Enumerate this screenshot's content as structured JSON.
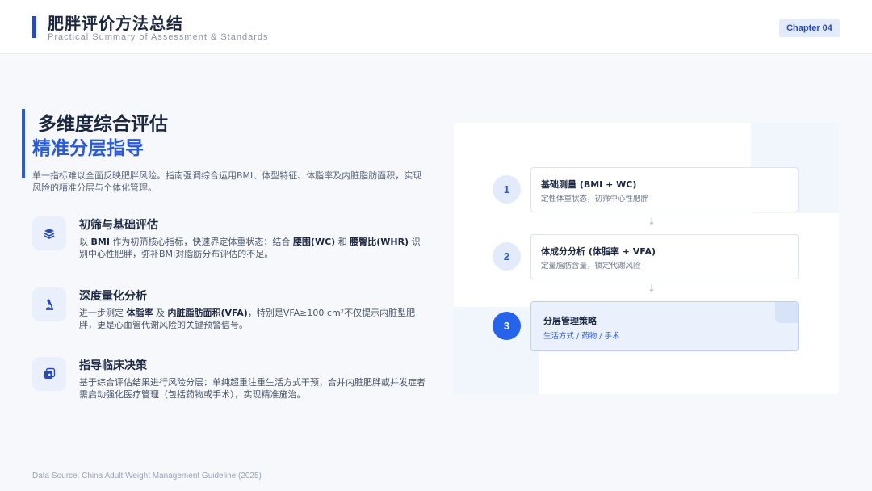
{
  "header": {
    "title": "肥胖评价方法总结",
    "subtitle": "Practical Summary of Assessment & Standards",
    "chapter": "Chapter 04"
  },
  "hero": {
    "line1": "多维度综合评估",
    "line2": "精准分层指导",
    "intro": "单一指标难以全面反映肥胖风险。指南强调综合运用BMI、体型特征、体脂率及内脏脂肪面积，实现风险的精准分层与个体化管理。"
  },
  "features": [
    {
      "icon": "layers-icon",
      "title": "初筛与基础评估",
      "desc": [
        " 以 ",
        "BMI",
        " 作为初筛核心指标，快速界定体重状态；结合 ",
        "腰围(WC)",
        " 和 ",
        "腰臀比(WHR)",
        " 识别中心性肥胖，弥补BMI对脂肪分布评估的不足。"
      ]
    },
    {
      "icon": "microscope-icon",
      "title": "深度量化分析",
      "desc": [
        "进一步测定 ",
        "体脂率",
        " 及 ",
        "内脏脂肪面积(VFA)",
        "，特别是VFA≥100 cm²不仅提示内脏型肥胖，更是心血管代谢风险的关键预警信号。"
      ]
    },
    {
      "icon": "medical-plus-icon",
      "title": "指导临床决策",
      "desc": [
        "基于综合评估结果进行风险分层：单纯超重注重生活方式干预，合并内脏肥胖或并发症者需启动强化医疗管理（包括药物或手术），实现精准施治。"
      ]
    }
  ],
  "steps": [
    {
      "num": "1",
      "title": "基础测量 (BMI + WC)",
      "sub": "定性体重状态，初筛中心性肥胖"
    },
    {
      "num": "2",
      "title": "体成分分析 (体脂率 + VFA)",
      "sub": "定量脂肪含量，锁定代谢风险"
    },
    {
      "num": "3",
      "title": "分层管理策略",
      "sub": "生活方式 / 药物 / 手术"
    }
  ],
  "arrow_glyph": "↓",
  "footer": "Data Source: China Adult Weight Management Guideline (2025)"
}
